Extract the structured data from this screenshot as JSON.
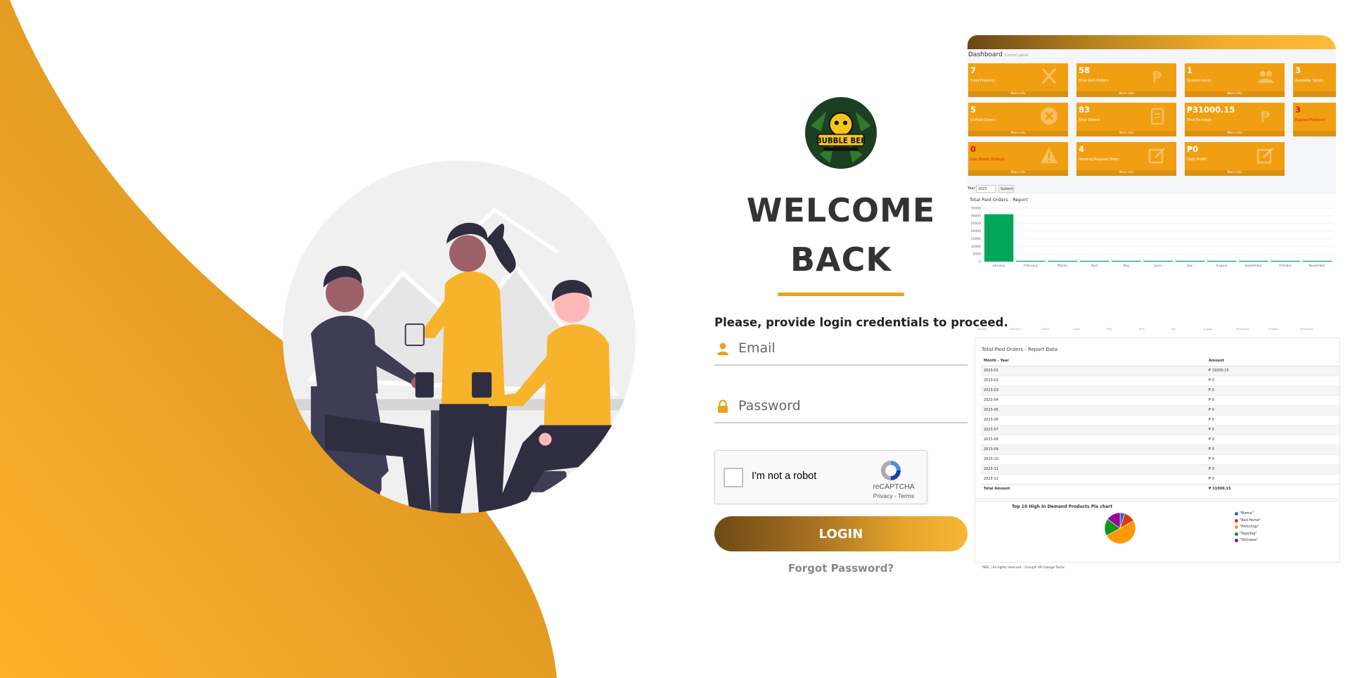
{
  "colors": {
    "accent": "#e8a21f",
    "brand_dark": "#6d4a14",
    "tile": "#f19f12",
    "chart_bar": "#00a65a"
  },
  "login": {
    "logo_text": "BUBBLE BEE",
    "welcome_line1": "WELCOME",
    "welcome_line2": "BACK",
    "prompt": "Please, provide login credentials to proceed.",
    "email_placeholder": "Email",
    "password_placeholder": "Password",
    "captcha_label": "I'm not a robot",
    "captcha_brand": "reCAPTCHA",
    "captcha_links": "Privacy - Terms",
    "login_button": "LOGIN",
    "forgot_password": "Forgot Password?",
    "icons": {
      "email": "user-icon",
      "password": "lock-icon"
    }
  },
  "dashboard": {
    "title": "Dashboard",
    "subtitle": "Control panel",
    "more_info": "More info",
    "tiles": [
      {
        "value": "7",
        "label": "Food Products",
        "icon": "utensils-icon"
      },
      {
        "value": "58",
        "label": "Total Paid Orders",
        "icon": "peso-icon"
      },
      {
        "value": "1",
        "label": "System Users",
        "icon": "users-icon"
      },
      {
        "value": "3",
        "label": "Available Tables",
        "icon": ""
      },
      {
        "value": "5",
        "label": "UnPaid Orders",
        "icon": "cancel-icon"
      },
      {
        "value": "83",
        "label": "Total Orders",
        "icon": "clipboard-icon"
      },
      {
        "value": "₱31000.15",
        "label": "Total Earnings",
        "icon": "peso-icon"
      },
      {
        "value": "3",
        "label": "Expired Products",
        "icon": ""
      },
      {
        "value": "0",
        "label": "Low Stocks Product",
        "icon": "warning-icon"
      },
      {
        "value": "4",
        "label": "Pending Request Order",
        "icon": "edit-icon"
      },
      {
        "value": "₱0",
        "label": "Daily Profit",
        "icon": "edit-icon"
      }
    ],
    "filter": {
      "label": "Year",
      "year": "2023",
      "submit": "Submit"
    }
  },
  "chart_data": [
    {
      "type": "bar",
      "title": "Total Paid Orders - Report",
      "categories": [
        "January",
        "February",
        "March",
        "April",
        "May",
        "June",
        "July",
        "August",
        "September",
        "October",
        "November"
      ],
      "values": [
        31000.15,
        0,
        0,
        0,
        0,
        0,
        0,
        0,
        0,
        0,
        0
      ],
      "yticks": [
        "35000",
        "30000",
        "25000",
        "20000",
        "15000",
        "10000",
        "5000",
        "0"
      ],
      "ylim": [
        0,
        35000
      ]
    },
    {
      "type": "pie",
      "title": "Top 10 High In Demand Products Pie chart",
      "categories": [
        "\"Mama\"",
        "\"Red Horse\"",
        "\"Porkchop\"",
        "\"Tapsilog\"",
        "\"Okinawa\""
      ],
      "values": [
        5,
        12,
        50,
        18,
        15
      ],
      "colors": [
        "#3366cc",
        "#dc3912",
        "#ff9900",
        "#109618",
        "#990099"
      ],
      "legend": "right"
    }
  ],
  "report": {
    "title": "Total Paid Orders - Report Data",
    "col_month": "Month - Year",
    "col_amount": "Amount",
    "rows": [
      {
        "month": "2023-01",
        "amount": "₱ 31000.15"
      },
      {
        "month": "2023-02",
        "amount": "₱ 0"
      },
      {
        "month": "2023-03",
        "amount": "₱ 0"
      },
      {
        "month": "2023-04",
        "amount": "₱ 0"
      },
      {
        "month": "2023-05",
        "amount": "₱ 0"
      },
      {
        "month": "2023-06",
        "amount": "₱ 0"
      },
      {
        "month": "2023-07",
        "amount": "₱ 0"
      },
      {
        "month": "2023-08",
        "amount": "₱ 0"
      },
      {
        "month": "2023-09",
        "amount": "₱ 0"
      },
      {
        "month": "2023-10",
        "amount": "₱ 0"
      },
      {
        "month": "2023-11",
        "amount": "₱ 0"
      },
      {
        "month": "2023-12",
        "amount": "₱ 0"
      }
    ],
    "total_label": "Total Amount",
    "total_value": "₱ 31000.15"
  },
  "footer": "*BEE | All rights reserved - Group# 09 College Tarlac"
}
